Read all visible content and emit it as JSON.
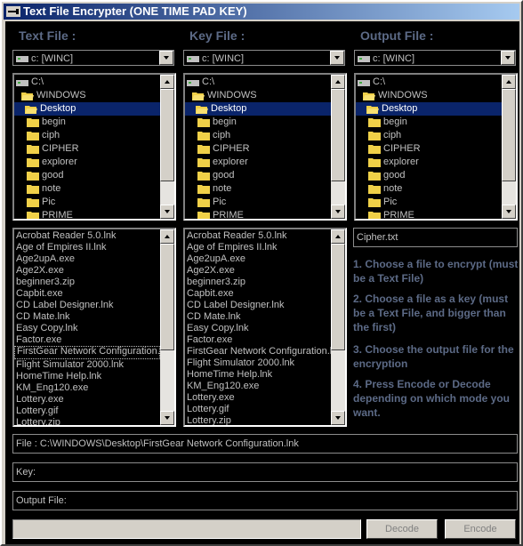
{
  "window": {
    "title": "Text File Encrypter (ONE TIME PAD KEY)"
  },
  "columns": [
    {
      "label": "Text File :",
      "drive": "c: [WINC]",
      "dirs": [
        "C:\\",
        "WINDOWS",
        "Desktop",
        "begin",
        "ciph",
        "CIPHER",
        "explorer",
        "good",
        "note",
        "Pic",
        "PRIME"
      ],
      "files": [
        "Acrobat Reader 5.0.lnk",
        "Age of Empires II.lnk",
        "Age2upA.exe",
        "Age2X.exe",
        "beginner3.zip",
        "Capbit.exe",
        "CD Label Designer.lnk",
        "CD Mate.lnk",
        "Easy Copy.lnk",
        "Factor.exe",
        "FirstGear Network Configuration.lnk",
        "Flight Simulator 2000.lnk",
        "HomeTime Help.lnk",
        "KM_Eng120.exe",
        "Lottery.exe",
        "Lottery.gif",
        "Lottery.zip"
      ]
    },
    {
      "label": "Key File :",
      "drive": "c: [WINC]",
      "dirs": [
        "C:\\",
        "WINDOWS",
        "Desktop",
        "begin",
        "ciph",
        "CIPHER",
        "explorer",
        "good",
        "note",
        "Pic",
        "PRIME"
      ],
      "files": [
        "Acrobat Reader 5.0.lnk",
        "Age of Empires II.lnk",
        "Age2upA.exe",
        "Age2X.exe",
        "beginner3.zip",
        "Capbit.exe",
        "CD Label Designer.lnk",
        "CD Mate.lnk",
        "Easy Copy.lnk",
        "Factor.exe",
        "FirstGear Network Configuration.lnk",
        "Flight Simulator 2000.lnk",
        "HomeTime Help.lnk",
        "KM_Eng120.exe",
        "Lottery.exe",
        "Lottery.gif",
        "Lottery.zip"
      ]
    },
    {
      "label": "Output File :",
      "drive": "c: [WINC]",
      "dirs": [
        "C:\\",
        "WINDOWS",
        "Desktop",
        "begin",
        "ciph",
        "CIPHER",
        "explorer",
        "good",
        "note",
        "Pic",
        "PRIME"
      ]
    }
  ],
  "output_name": "Cipher.txt",
  "instructions": [
    "1. Choose a file to encrypt (must be a Text File)",
    "2. Choose a file as a key (must be a Text File, and bigger than the first)",
    "3. Choose the output file for the encryption",
    "4. Press Encode or Decode depending on which mode you want."
  ],
  "status": {
    "file": "File : C:\\WINDOWS\\Desktop\\FirstGear Network Configuration.lnk",
    "key": "Key:",
    "output": "Output File:"
  },
  "buttons": {
    "decode": "Decode",
    "encode": "Encode"
  },
  "colors": {
    "accent_text": "#5c6a86",
    "selection": "#0a246a",
    "folder": "#f0d048"
  }
}
